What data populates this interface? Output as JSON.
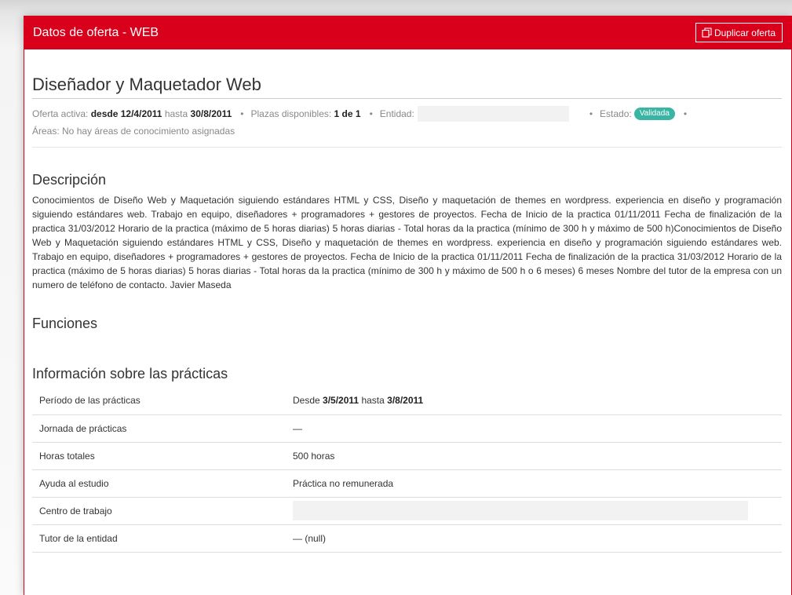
{
  "header": {
    "title": "Datos de oferta - WEB",
    "duplicate_label": "Duplicar oferta"
  },
  "offer": {
    "title": "Diseñador y Maquetador Web",
    "active_label": "Oferta activa:",
    "desde": "desde",
    "start_date": "12/4/2011",
    "hasta": "hasta",
    "end_date": "30/8/2011",
    "plazas_label": "Plazas disponibles:",
    "plazas_value": "1 de 1",
    "entidad_label": "Entidad:",
    "estado_label": "Estado:",
    "estado_value": "Validada",
    "areas_text": "Áreas: No hay áreas de conocimiento asignadas"
  },
  "description": {
    "title": "Descripción",
    "text": "Conocimientos de Diseño Web y Maquetación siguiendo estándares HTML y CSS, Diseño y maquetación de themes en wordpress. experiencia en diseño y programación siguiendo estándares web. Trabajo en equipo, diseñadores + programadores + gestores de proyectos. Fecha de Inicio de la practica 01/11/2011 Fecha de finalización de la practica 31/03/2012 Horario de la practica (máximo de 5 horas diarias) 5 horas diarias - Total horas da la practica (mínimo de 300 h y máximo de 500 h)Conocimientos de Diseño Web y Maquetación siguiendo estándares HTML y CSS, Diseño y maquetación de themes en wordpress. experiencia en diseño y programación siguiendo estándares web. Trabajo en equipo, diseñadores + programadores + gestores de proyectos. Fecha de Inicio de la practica 01/11/2011 Fecha de finalización de la practica 31/03/2012 Horario de la practica (máximo de 5 horas diarias) 5 horas diarias - Total horas da la practica (mínimo de 300 h y máximo de 500 h o 6 meses) 6 meses Nombre del tutor de la empresa con un numero de teléfono de contacto. Javier Maseda"
  },
  "functions": {
    "title": "Funciones"
  },
  "practicas": {
    "title": "Información sobre las prácticas",
    "rows": [
      {
        "label": "Período de las prácticas",
        "prefix": "Desde",
        "start": "3/5/2011",
        "mid": "hasta",
        "end": "3/8/2011"
      },
      {
        "label": "Jornada de prácticas",
        "value": "—"
      },
      {
        "label": "Horas totales",
        "value": "500 horas"
      },
      {
        "label": "Ayuda al estudio",
        "value": "Práctica no remunerada"
      },
      {
        "label": "Centro de trabajo",
        "value": ""
      },
      {
        "label": "Tutor de la entidad",
        "value": "— (null)"
      }
    ]
  },
  "colors": {
    "brand_red": "#d9001b",
    "badge_teal": "#3bb5a3"
  },
  "icons": {
    "duplicate": "copy-icon"
  }
}
